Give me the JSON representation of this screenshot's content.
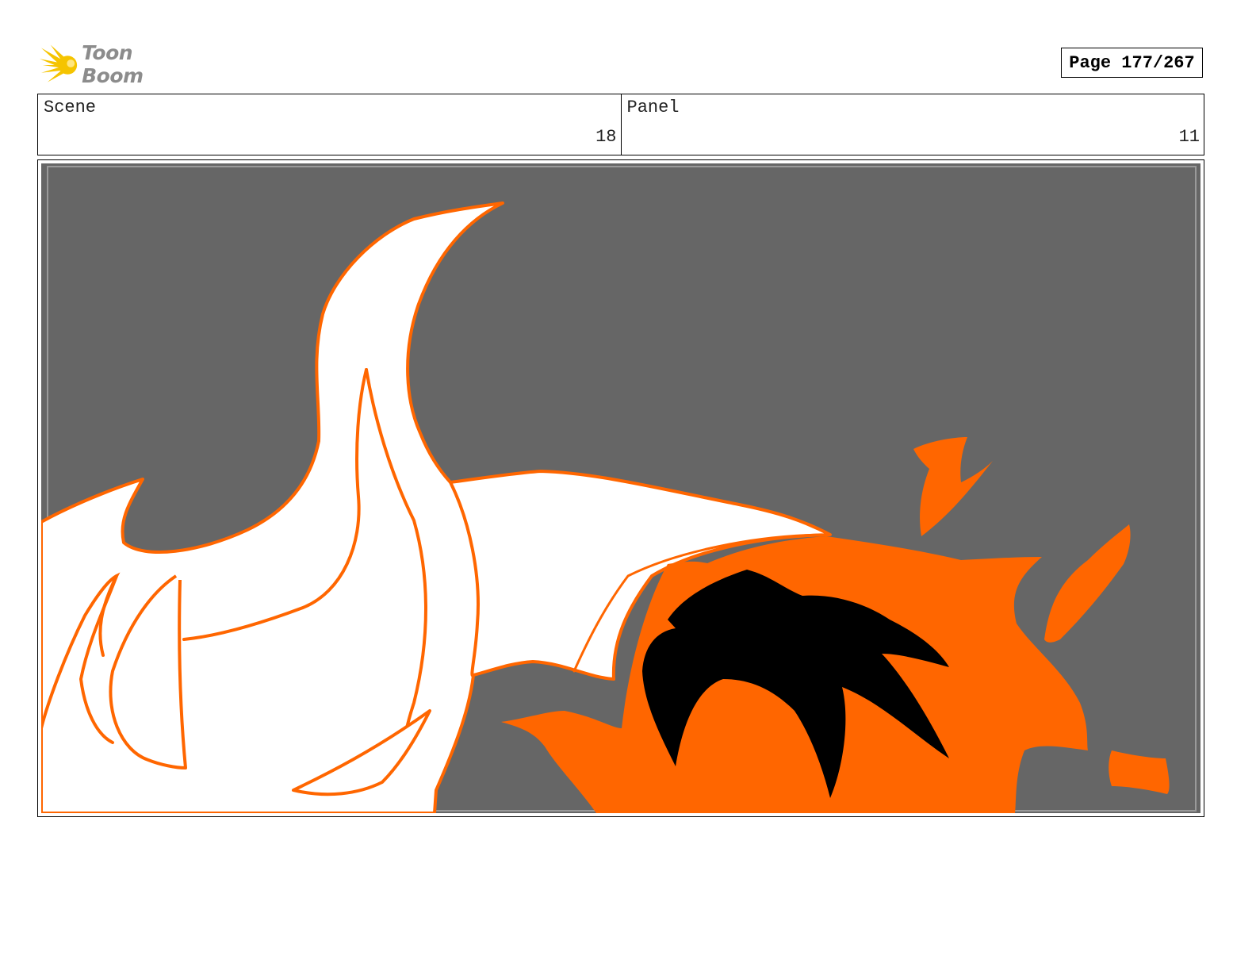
{
  "logo": {
    "text": "Toon Boom",
    "icon": "starburst-icon",
    "color": "#f5c400"
  },
  "page": {
    "label": "Page 177/267"
  },
  "header": {
    "scene_label": "Scene",
    "scene_value": "18",
    "panel_label": "Panel",
    "panel_value": "11"
  },
  "drawing": {
    "colors": {
      "background": "#666666",
      "outline": "#ff6600",
      "fill_orange": "#ff6600",
      "fill_white": "#ffffff",
      "fill_black": "#000000"
    }
  }
}
